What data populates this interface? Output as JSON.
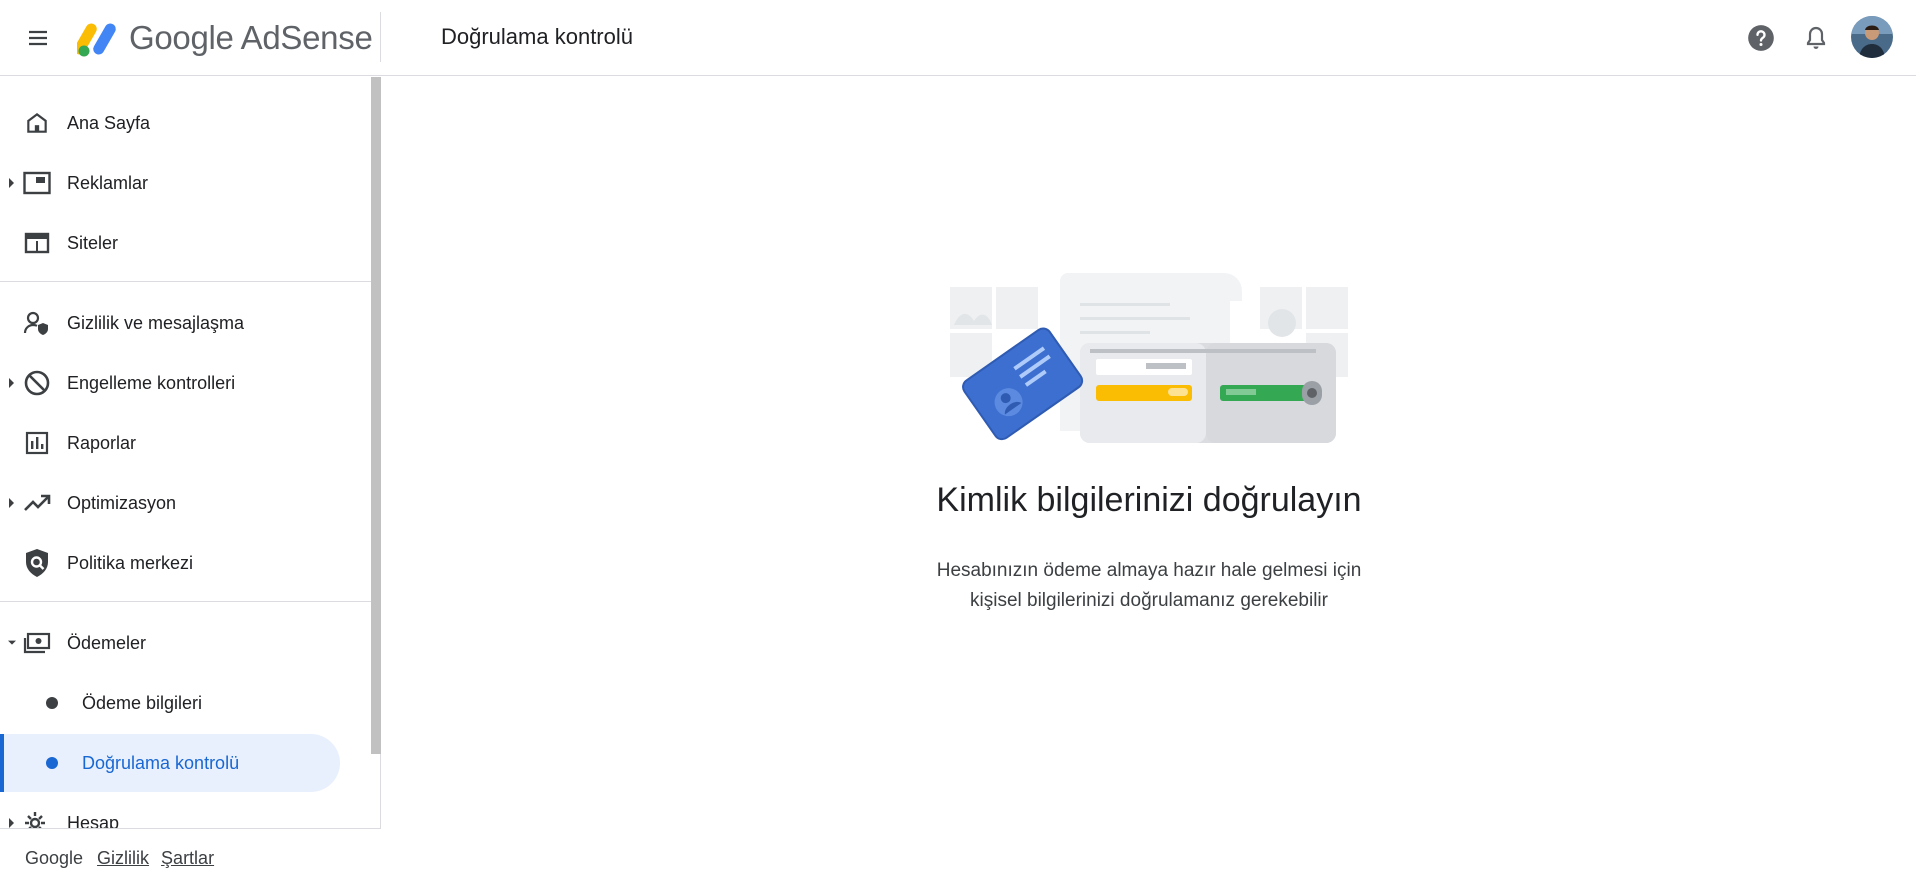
{
  "header": {
    "app_name": "Google AdSense",
    "page_title": "Doğrulama kontrolü",
    "icons": [
      "menu-icon",
      "help-icon",
      "notifications-icon"
    ]
  },
  "sidebar": {
    "items": [
      {
        "label": "Ana Sayfa",
        "icon": "home-icon",
        "expandable": false
      },
      {
        "label": "Reklamlar",
        "icon": "ads-icon",
        "expandable": true
      },
      {
        "label": "Siteler",
        "icon": "sites-icon",
        "expandable": false
      },
      {
        "label": "Gizlilik ve mesajlaşma",
        "icon": "privacy-icon",
        "expandable": false
      },
      {
        "label": "Engelleme kontrolleri",
        "icon": "block-icon",
        "expandable": true
      },
      {
        "label": "Raporlar",
        "icon": "reports-icon",
        "expandable": false
      },
      {
        "label": "Optimizasyon",
        "icon": "trending-icon",
        "expandable": true
      },
      {
        "label": "Politika merkezi",
        "icon": "policy-icon",
        "expandable": false
      },
      {
        "label": "Ödemeler",
        "icon": "payments-icon",
        "expandable": true,
        "expanded": true
      },
      {
        "label": "Hesap",
        "icon": "settings-icon",
        "expandable": true
      }
    ],
    "sub_items": [
      {
        "label": "Ödeme bilgileri",
        "active": false
      },
      {
        "label": "Doğrulama kontrolü",
        "active": true
      }
    ]
  },
  "footer": {
    "google": "Google",
    "privacy": "Gizlilik",
    "terms": "Şartlar"
  },
  "main": {
    "heading": "Kimlik bilgilerinizi doğrulayın",
    "description_line1": "Hesabınızın ödeme almaya hazır hale gelmesi için",
    "description_line2": "kişisel bilgilerinizi doğrulamanız gerekebilir"
  },
  "colors": {
    "accent": "#1967d2",
    "active_bg": "#e8f0fe",
    "divider": "#dadce0"
  }
}
